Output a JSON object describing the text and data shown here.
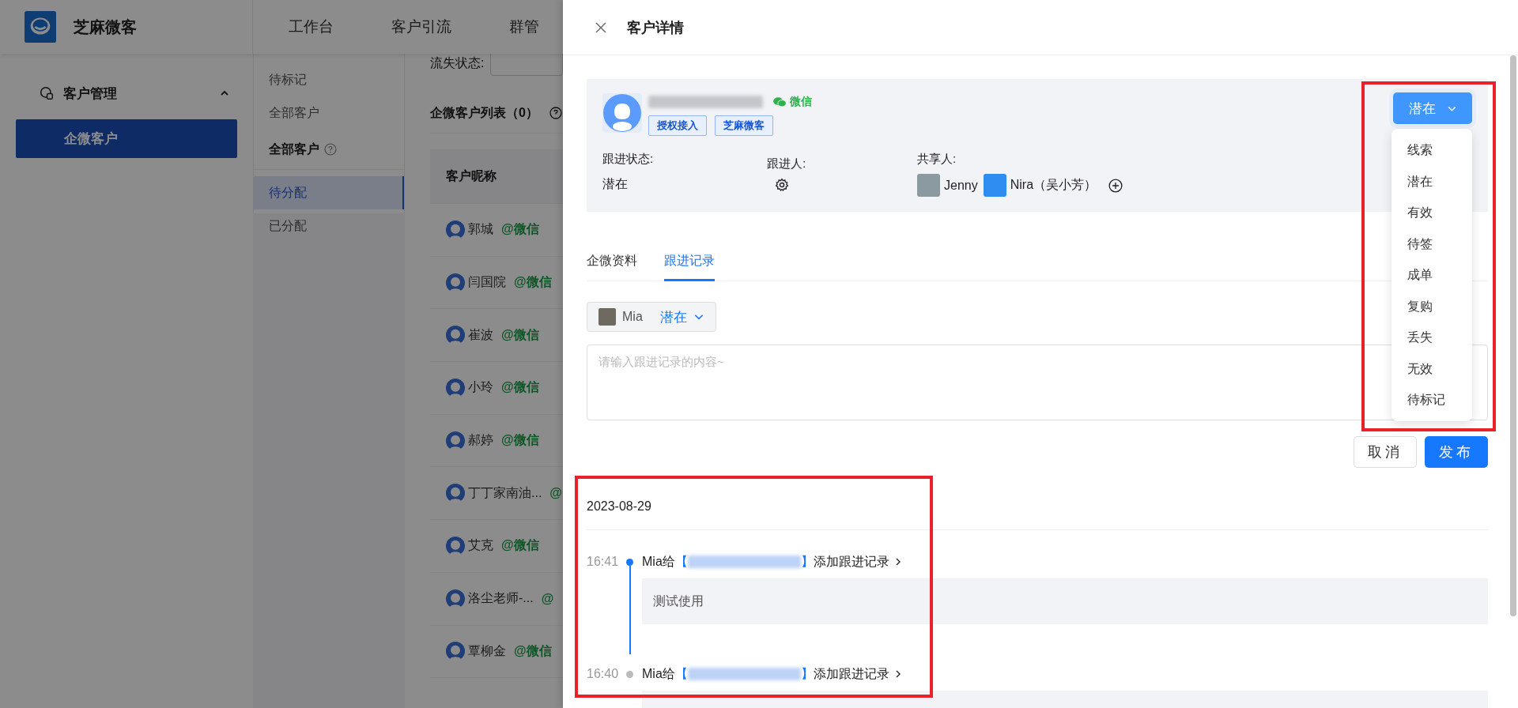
{
  "app": {
    "logo_text": "芝麻微客"
  },
  "top_nav": [
    {
      "label": "工作台"
    },
    {
      "label": "客户引流"
    },
    {
      "label": "群管"
    }
  ],
  "sidebar": {
    "group": {
      "label": "客户管理",
      "expanded": true
    },
    "items": [
      {
        "label": "企微客户",
        "selected": true
      }
    ]
  },
  "sub_menu": [
    {
      "label": "待标记",
      "kind": "item",
      "selected": false
    },
    {
      "label": "全部客户",
      "kind": "item",
      "selected": false
    },
    {
      "label": "全部客户",
      "kind": "heading"
    },
    {
      "label": "待分配",
      "kind": "item",
      "selected": true
    },
    {
      "label": "已分配",
      "kind": "item",
      "selected": false
    }
  ],
  "filter": {
    "label": "流失状态:"
  },
  "list": {
    "title": "企微客户列表（0）",
    "columns": [
      {
        "label": "客户昵称"
      }
    ],
    "rows": [
      {
        "name": "郭城",
        "source": "@微信"
      },
      {
        "name": "闫国院",
        "source": "@微信"
      },
      {
        "name": "崔波",
        "source": "@微信"
      },
      {
        "name": "小玲",
        "source": "@微信"
      },
      {
        "name": "郝婷",
        "source": "@微信"
      },
      {
        "name": "丁丁家南油...",
        "source": "@"
      },
      {
        "name": "艾克",
        "source": "@微信"
      },
      {
        "name": "洛尘老师-...",
        "source": "@"
      },
      {
        "name": "覃柳金",
        "source": "@微信"
      }
    ]
  },
  "drawer": {
    "title": "客户详情",
    "customer": {
      "channel": "微信",
      "tags": [
        "授权接入",
        "芝麻微客"
      ]
    },
    "status_label": "跟进状态:",
    "status_value": "潜在",
    "owner_label": "跟进人:",
    "sharers_label": "共享人:",
    "sharers": [
      {
        "name": "Jenny",
        "color": "#8a9aa0"
      },
      {
        "name": "Nira（吴小芳）",
        "color": "#2f8cf0"
      }
    ],
    "status_button": {
      "label": "潜在",
      "expanded": true
    },
    "status_options": [
      {
        "label": "线索",
        "selected": false
      },
      {
        "label": "潜在",
        "selected": false
      },
      {
        "label": "有效",
        "selected": false
      },
      {
        "label": "待签",
        "selected": false
      },
      {
        "label": "成单",
        "selected": false
      },
      {
        "label": "复购",
        "selected": false
      },
      {
        "label": "丢失",
        "selected": false
      },
      {
        "label": "无效",
        "selected": false
      },
      {
        "label": "待标记",
        "selected": false
      }
    ],
    "tabs": [
      {
        "label": "企微资料",
        "selected": false
      },
      {
        "label": "跟进记录",
        "selected": true
      }
    ],
    "follower_chip": {
      "name": "Mia",
      "status": "潜在"
    },
    "note_field": {
      "placeholder": "请输入跟进记录的内容~"
    },
    "buttons": [
      {
        "label": "取消",
        "kind": "secondary"
      },
      {
        "label": "发布",
        "kind": "primary"
      }
    ],
    "timeline": {
      "date": "2023-08-29",
      "entries": [
        {
          "time": "16:41",
          "author": "Mia给",
          "open": "【",
          "close": "】",
          "action": "添加跟进记录",
          "content": "测试使用",
          "active": true
        },
        {
          "time": "16:40",
          "author": "Mia给",
          "open": "【",
          "close": "】",
          "action": "添加跟进记录",
          "active": false
        }
      ]
    }
  }
}
